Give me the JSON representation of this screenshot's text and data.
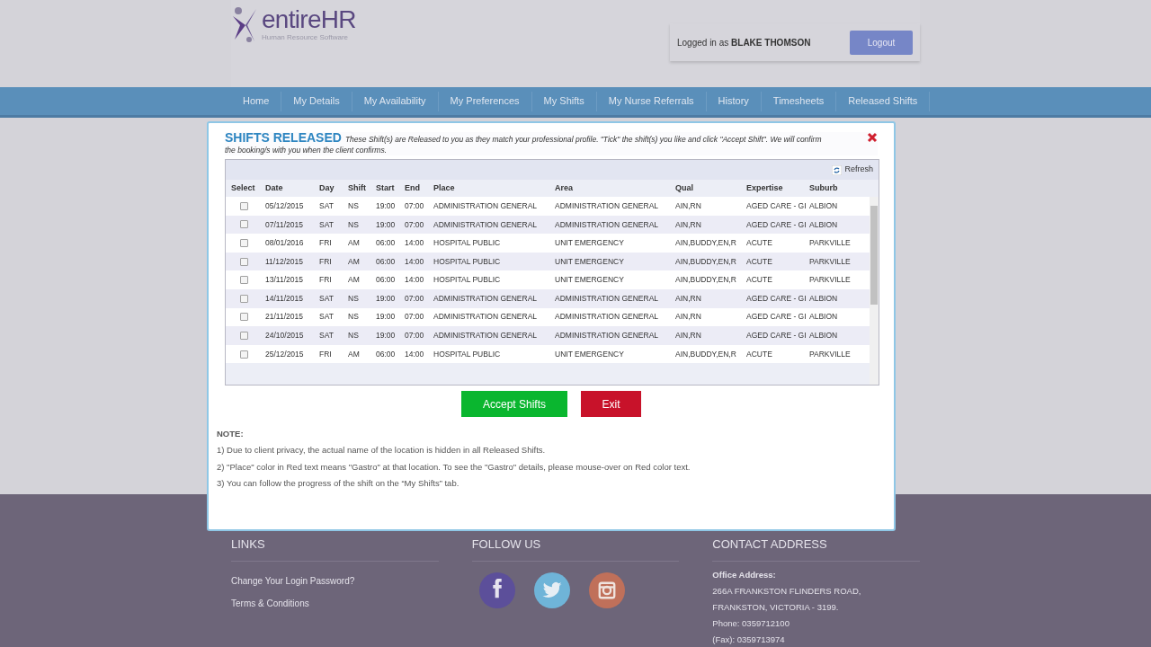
{
  "header": {
    "logo_name": "entireHR",
    "logo_tagline": "Human Resource Software",
    "login_prefix": "Logged in as",
    "user": "BLAKE THOMSON",
    "logout": "Logout"
  },
  "nav": [
    "Home",
    "My Details",
    "My Availability",
    "My Preferences",
    "My Shifts",
    "My Nurse Referrals",
    "History",
    "Timesheets",
    "Released Shifts"
  ],
  "modal": {
    "title": "SHIFTS RELEASED",
    "intro": "These Shift(s) are Released to you as they match your professional profile. \"Tick\" the shift(s) you like and click \"Accept Shift\". We will confirm the booking/s with you when the client confirms.",
    "refresh": "Refresh",
    "select_label": "Select",
    "columns": [
      "Date",
      "Day",
      "Shift",
      "Start",
      "End",
      "Place",
      "Area",
      "Qual",
      "Expertise",
      "Suburb"
    ],
    "rows": [
      {
        "checked": false,
        "cells": [
          "05/12/2015",
          "SAT",
          "NS",
          "19:00",
          "07:00",
          "ADMINISTRATION GENERAL",
          "ADMINISTRATION GENERAL",
          "AIN,RN",
          "AGED CARE - GI",
          "ALBION"
        ]
      },
      {
        "checked": false,
        "cells": [
          "07/11/2015",
          "SAT",
          "NS",
          "19:00",
          "07:00",
          "ADMINISTRATION GENERAL",
          "ADMINISTRATION GENERAL",
          "AIN,RN",
          "AGED CARE - GI",
          "ALBION"
        ]
      },
      {
        "checked": false,
        "cells": [
          "08/01/2016",
          "FRI",
          "AM",
          "06:00",
          "14:00",
          "HOSPITAL PUBLIC",
          "UNIT EMERGENCY",
          "AIN,BUDDY,EN,R",
          "ACUTE",
          "PARKVILLE"
        ]
      },
      {
        "checked": false,
        "cells": [
          "11/12/2015",
          "FRI",
          "AM",
          "06:00",
          "14:00",
          "HOSPITAL PUBLIC",
          "UNIT EMERGENCY",
          "AIN,BUDDY,EN,R",
          "ACUTE",
          "PARKVILLE"
        ]
      },
      {
        "checked": false,
        "cells": [
          "13/11/2015",
          "FRI",
          "AM",
          "06:00",
          "14:00",
          "HOSPITAL PUBLIC",
          "UNIT EMERGENCY",
          "AIN,BUDDY,EN,R",
          "ACUTE",
          "PARKVILLE"
        ]
      },
      {
        "checked": false,
        "cells": [
          "14/11/2015",
          "SAT",
          "NS",
          "19:00",
          "07:00",
          "ADMINISTRATION GENERAL",
          "ADMINISTRATION GENERAL",
          "AIN,RN",
          "AGED CARE - GI",
          "ALBION"
        ]
      },
      {
        "checked": false,
        "cells": [
          "21/11/2015",
          "SAT",
          "NS",
          "19:00",
          "07:00",
          "ADMINISTRATION GENERAL",
          "ADMINISTRATION GENERAL",
          "AIN,RN",
          "AGED CARE - GI",
          "ALBION"
        ]
      },
      {
        "checked": false,
        "cells": [
          "24/10/2015",
          "SAT",
          "NS",
          "19:00",
          "07:00",
          "ADMINISTRATION GENERAL",
          "ADMINISTRATION GENERAL",
          "AIN,RN",
          "AGED CARE - GI",
          "ALBION"
        ]
      },
      {
        "checked": false,
        "cells": [
          "25/12/2015",
          "FRI",
          "AM",
          "06:00",
          "14:00",
          "HOSPITAL PUBLIC",
          "UNIT EMERGENCY",
          "AIN,BUDDY,EN,R",
          "ACUTE",
          "PARKVILLE"
        ]
      }
    ],
    "accept": "Accept Shifts",
    "exit": "Exit",
    "note_title": "NOTE:",
    "notes": [
      "1) Due to client privacy, the actual name of the location is hidden in all Released Shifts.",
      "2) \"Place\" color in Red text means \"Gastro\" at that location. To see the \"Gastro\" details, please mouse-over on Red color text.",
      "3) You can follow the progress of the shift on the “My Shifts” tab."
    ]
  },
  "footer": {
    "links_title": "LINKS",
    "links": [
      "Change Your Login Password?",
      "Terms & Conditions"
    ],
    "follow_title": "FOLLOW US",
    "social": [
      {
        "kind": "facebook",
        "color": "#5c4f9a"
      },
      {
        "kind": "twitter",
        "color": "#6fb4d8"
      },
      {
        "kind": "instagram",
        "color": "#c0705a"
      }
    ],
    "contact_title": "CONTACT ADDRESS",
    "office_label": "Office Address:",
    "contact_lines": [
      "266A FRANKSTON FLINDERS ROAD,",
      "FRANKSTON, VICTORIA - 3199.",
      "Phone: 0359712100",
      "(Fax): 0359713974"
    ]
  }
}
